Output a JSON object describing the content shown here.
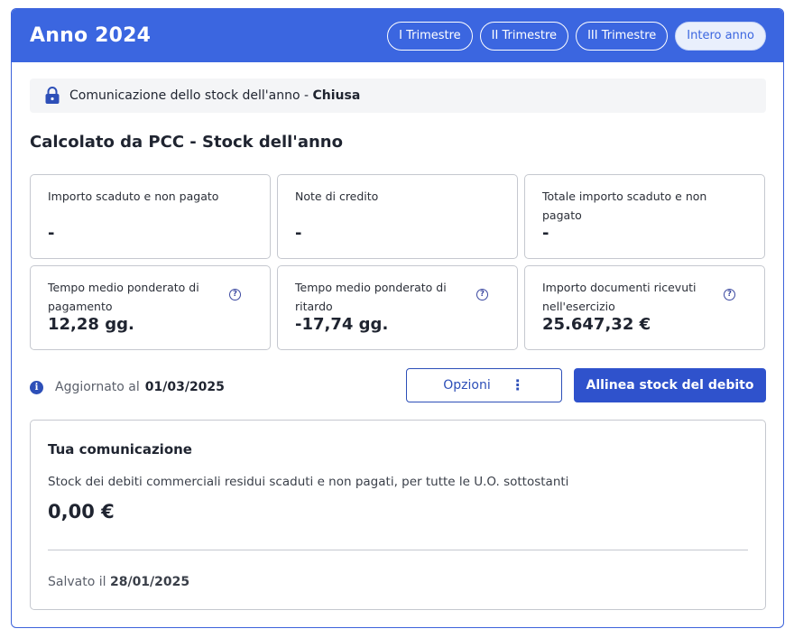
{
  "header": {
    "title": "Anno 2024",
    "tabs": [
      {
        "label": "I Trimestre",
        "active": false
      },
      {
        "label": "II Trimestre",
        "active": false
      },
      {
        "label": "III Trimestre",
        "active": false
      },
      {
        "label": "Intero anno",
        "active": true
      }
    ]
  },
  "status": {
    "icon": "lock-icon",
    "text": "Comunicazione dello stock dell'anno",
    "separator": " - ",
    "state": "Chiusa"
  },
  "section": {
    "title": "Calcolato da PCC - Stock dell'anno"
  },
  "stats": [
    {
      "label": "Importo scaduto e non pagato",
      "value": "-",
      "help": false
    },
    {
      "label": "Note di credito",
      "value": "-",
      "help": false
    },
    {
      "label": "Totale importo scaduto e non pagato",
      "value": "-",
      "help": false
    },
    {
      "label": "Tempo medio ponderato di pagamento",
      "value": "12,28 gg.",
      "help": true
    },
    {
      "label": "Tempo medio ponderato di ritardo",
      "value": "-17,74 gg.",
      "help": true
    },
    {
      "label": "Importo documenti ricevuti nell'esercizio",
      "value": "25.647,32 €",
      "help": true
    }
  ],
  "updated": {
    "icon": "info-icon",
    "label": "Aggiornato al",
    "date": "01/03/2025"
  },
  "actions": {
    "options_label": "Opzioni",
    "options_icon": "kebab-menu-icon",
    "align_label": "Allinea stock del debito"
  },
  "communication": {
    "title": "Tua comunicazione",
    "description": "Stock dei debiti commerciali residui scaduti e non pagati, per tutte le U.O. sottostanti",
    "value": "0,00 €",
    "saved_label": "Salvato il",
    "saved_date": "28/01/2025"
  },
  "colors": {
    "header": "#3b66e0",
    "primary": "#2f52cc"
  }
}
